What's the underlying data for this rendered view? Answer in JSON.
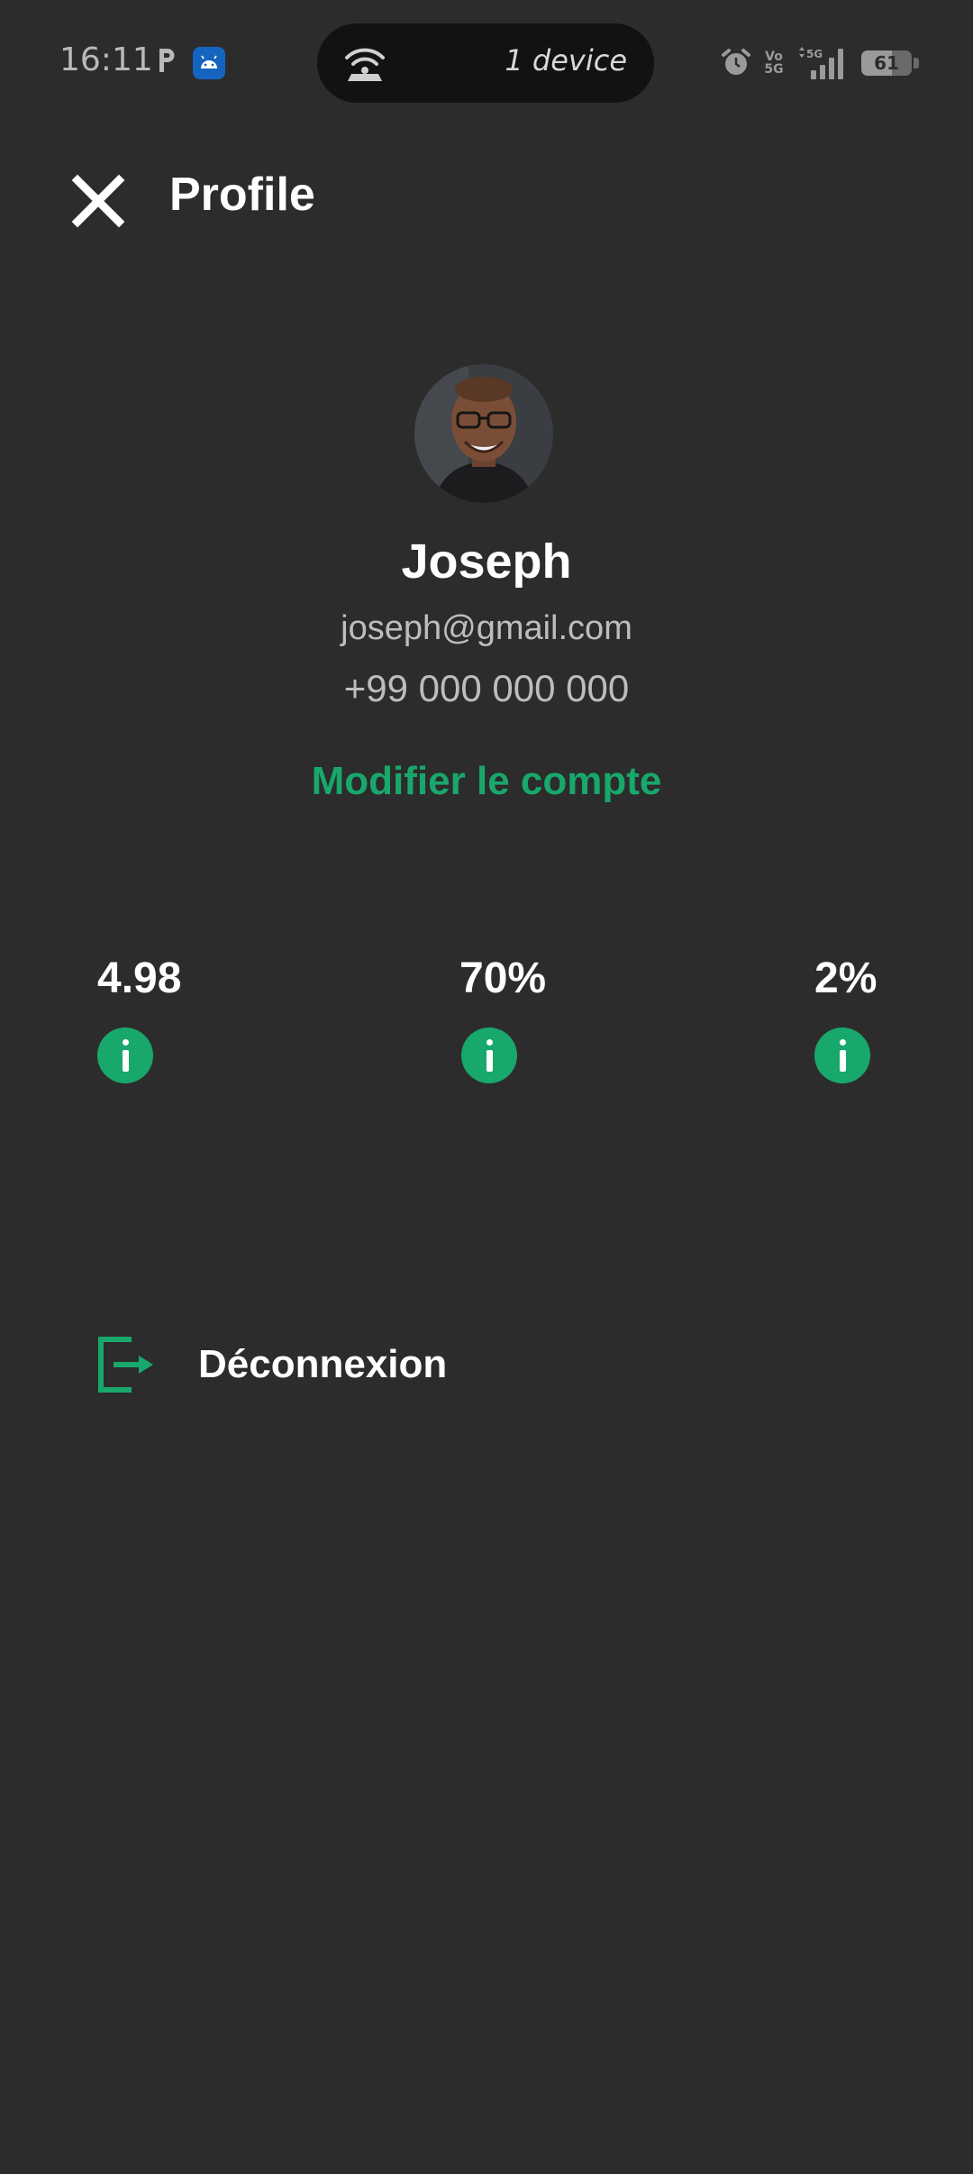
{
  "status_bar": {
    "time": "16:11",
    "hotspot_text": "1 device",
    "network_type": "5G",
    "volte_label": "Vo\n5G",
    "battery_level": "61",
    "icons": [
      "p-icon",
      "android-notification-icon",
      "hotspot-icon",
      "alarm-icon",
      "volte-icon",
      "signal-icon",
      "battery-icon"
    ]
  },
  "header": {
    "title": "Profile",
    "close_icon": "close-icon"
  },
  "profile": {
    "name": "Joseph",
    "email": "joseph@gmail.com",
    "phone": "+99 000 000 000",
    "edit_label": "Modifier le compte"
  },
  "stats": [
    {
      "value": "4.98",
      "icon": "info-icon"
    },
    {
      "value": "70%",
      "icon": "info-icon"
    },
    {
      "value": "2%",
      "icon": "info-icon"
    }
  ],
  "logout": {
    "label": "Déconnexion",
    "icon": "logout-icon"
  },
  "colors": {
    "background": "#2c2c2c",
    "accent": "#18a86b",
    "secondary_text": "#bdbdbd"
  }
}
